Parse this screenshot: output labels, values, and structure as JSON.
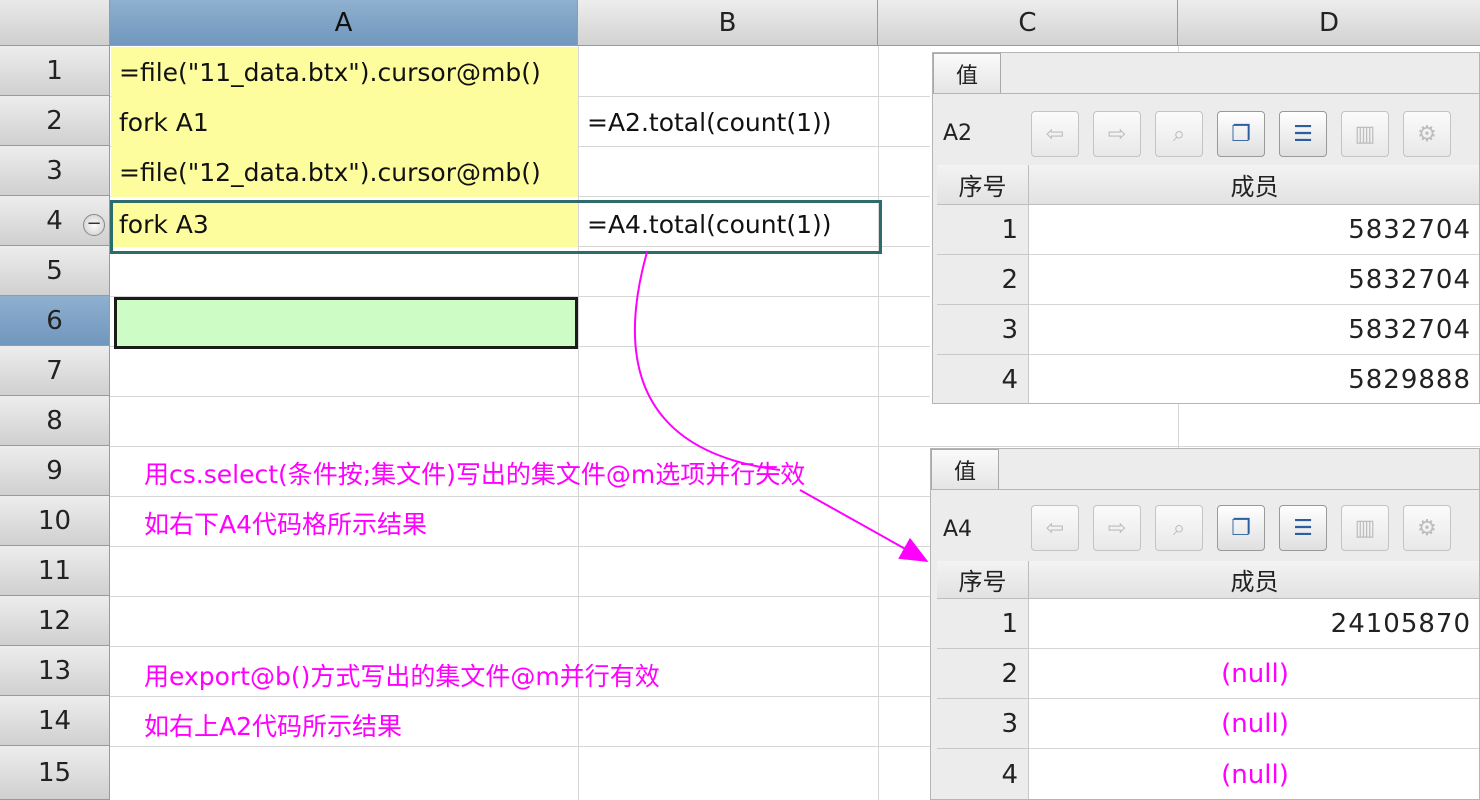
{
  "columns": [
    "A",
    "B",
    "C",
    "D"
  ],
  "rows": [
    "1",
    "2",
    "3",
    "4",
    "5",
    "6",
    "7",
    "8",
    "9",
    "10",
    "11",
    "12",
    "13",
    "14",
    "15"
  ],
  "selected_column": "A",
  "selected_row": "6",
  "cells": {
    "A1": "=file(\"11_data.btx\").cursor@mb()",
    "A2": "fork A1",
    "B2": "=A2.total(count(1))",
    "A3": "=file(\"12_data.btx\").cursor@mb()",
    "A4": "fork A3",
    "B4": "=A4.total(count(1))"
  },
  "notes": {
    "n1": "用cs.select(条件按;集文件)写出的集文件@m选项并行失效",
    "n2": "如右下A4代码格所示结果",
    "n3": "用export@b()方式写出的集文件@m并行有效",
    "n4": "如右上A2代码所示结果"
  },
  "colors": {
    "note": "#ff00ff",
    "code_cell": "#fdfd9e",
    "active_cell": "#cdfdc5",
    "selection_border": "#2e6c6c",
    "header_selected": "#7f9fc0"
  },
  "panel_top": {
    "tab": "值",
    "cell_ref": "A2",
    "headers": [
      "序号",
      "成员"
    ],
    "rows": [
      {
        "idx": "1",
        "value": "5832704"
      },
      {
        "idx": "2",
        "value": "5832704"
      },
      {
        "idx": "3",
        "value": "5832704"
      },
      {
        "idx": "4",
        "value": "5829888"
      }
    ]
  },
  "panel_bottom": {
    "tab": "值",
    "cell_ref": "A4",
    "headers": [
      "序号",
      "成员"
    ],
    "rows": [
      {
        "idx": "1",
        "value": "24105870"
      },
      {
        "idx": "2",
        "value": "(null)"
      },
      {
        "idx": "3",
        "value": "(null)"
      },
      {
        "idx": "4",
        "value": "(null)"
      }
    ]
  },
  "toolbar_icons": [
    "back-arrow-icon",
    "forward-arrow-icon",
    "zoom-icon",
    "copy-icon",
    "list-icon",
    "chart-icon",
    "settings-icon"
  ],
  "toolbar_glyphs": [
    "⇦",
    "⇨",
    "⌕",
    "❐",
    "☰",
    "▥",
    "⚙"
  ]
}
